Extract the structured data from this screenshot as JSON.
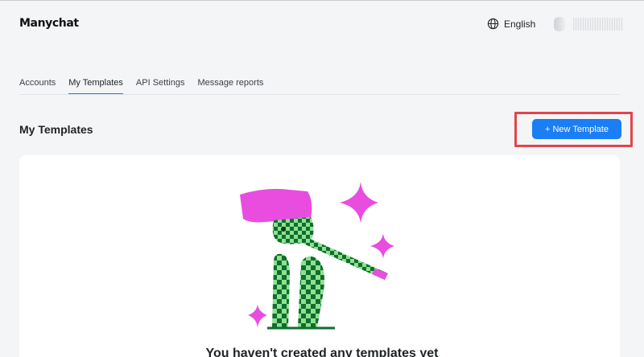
{
  "header": {
    "logo_text": "Manychat",
    "language": "English",
    "globe_icon": "globe-icon"
  },
  "tabs": [
    {
      "label": "Accounts",
      "active": false
    },
    {
      "label": "My Templates",
      "active": true
    },
    {
      "label": "API Settings",
      "active": false
    },
    {
      "label": "Message reports",
      "active": false
    }
  ],
  "main": {
    "title": "My Templates",
    "new_template_button": "+ New Template",
    "empty_state_text": "You haven't created any templates yet"
  },
  "colors": {
    "accent": "#1a7ef5",
    "highlight": "#e1454b",
    "magenta": "#e84de0",
    "dark_green": "#0f6e2f",
    "light_green": "#8fe08f"
  }
}
